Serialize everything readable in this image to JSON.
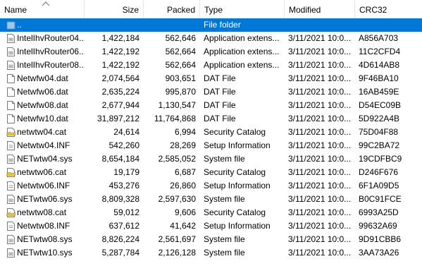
{
  "columns": {
    "name": "Name",
    "size": "Size",
    "packed": "Packed",
    "type": "Type",
    "modified": "Modified",
    "crc": "CRC32"
  },
  "rows": [
    {
      "name": "..",
      "size": "",
      "packed": "",
      "type": "File folder",
      "modified": "",
      "crc": "",
      "icon": "folder-up-icon",
      "selected": true
    },
    {
      "name": "IntelIhvRouter04...",
      "size": "1,422,184",
      "packed": "562,646",
      "type": "Application extens...",
      "modified": "3/11/2021 10:0...",
      "crc": "A856A703",
      "icon": "dll-file-icon"
    },
    {
      "name": "IntelIhvRouter06...",
      "size": "1,422,192",
      "packed": "562,664",
      "type": "Application extens...",
      "modified": "3/11/2021 10:0...",
      "crc": "11C2CFD4",
      "icon": "dll-file-icon"
    },
    {
      "name": "IntelIhvRouter08...",
      "size": "1,422,192",
      "packed": "562,664",
      "type": "Application extens...",
      "modified": "3/11/2021 10:0...",
      "crc": "4D614AB8",
      "icon": "dll-file-icon"
    },
    {
      "name": "Netwfw04.dat",
      "size": "2,074,564",
      "packed": "903,651",
      "type": "DAT File",
      "modified": "3/11/2021 10:0...",
      "crc": "9F46BA10",
      "icon": "file-icon"
    },
    {
      "name": "Netwfw06.dat",
      "size": "2,635,224",
      "packed": "995,870",
      "type": "DAT File",
      "modified": "3/11/2021 10:0...",
      "crc": "16AB459E",
      "icon": "file-icon"
    },
    {
      "name": "Netwfw08.dat",
      "size": "2,677,944",
      "packed": "1,130,547",
      "type": "DAT File",
      "modified": "3/11/2021 10:0...",
      "crc": "D54EC09B",
      "icon": "file-icon"
    },
    {
      "name": "Netwfw10.dat",
      "size": "31,897,212",
      "packed": "11,764,868",
      "type": "DAT File",
      "modified": "3/11/2021 10:0...",
      "crc": "5D922A4B",
      "icon": "file-icon"
    },
    {
      "name": "netwtw04.cat",
      "size": "24,614",
      "packed": "6,994",
      "type": "Security Catalog",
      "modified": "3/11/2021 10:0...",
      "crc": "75D04F88",
      "icon": "security-catalog-icon"
    },
    {
      "name": "Netwtw04.INF",
      "size": "542,260",
      "packed": "28,269",
      "type": "Setup Information",
      "modified": "3/11/2021 10:0...",
      "crc": "99C2BA72",
      "icon": "setup-info-icon"
    },
    {
      "name": "NETwtw04.sys",
      "size": "8,654,184",
      "packed": "2,585,052",
      "type": "System file",
      "modified": "3/11/2021 10:0...",
      "crc": "19CDFBC9",
      "icon": "system-file-icon"
    },
    {
      "name": "netwtw06.cat",
      "size": "19,179",
      "packed": "6,687",
      "type": "Security Catalog",
      "modified": "3/11/2021 10:0...",
      "crc": "D246F676",
      "icon": "security-catalog-icon"
    },
    {
      "name": "Netwtw06.INF",
      "size": "453,276",
      "packed": "26,860",
      "type": "Setup Information",
      "modified": "3/11/2021 10:0...",
      "crc": "6F1A09D5",
      "icon": "setup-info-icon"
    },
    {
      "name": "NETwtw06.sys",
      "size": "8,809,328",
      "packed": "2,597,630",
      "type": "System file",
      "modified": "3/11/2021 10:0...",
      "crc": "B0C91FCE",
      "icon": "system-file-icon"
    },
    {
      "name": "netwtw08.cat",
      "size": "59,012",
      "packed": "9,606",
      "type": "Security Catalog",
      "modified": "3/11/2021 10:0...",
      "crc": "6993A25D",
      "icon": "security-catalog-icon"
    },
    {
      "name": "Netwtw08.INF",
      "size": "637,612",
      "packed": "41,642",
      "type": "Setup Information",
      "modified": "3/11/2021 10:0...",
      "crc": "99632A69",
      "icon": "setup-info-icon"
    },
    {
      "name": "NETwtw08.sys",
      "size": "8,826,224",
      "packed": "2,561,697",
      "type": "System file",
      "modified": "3/11/2021 10:0...",
      "crc": "9D91CBB6",
      "icon": "system-file-icon"
    },
    {
      "name": "NETwtw10.sys",
      "size": "5,287,784",
      "packed": "2,126,128",
      "type": "System file",
      "modified": "3/11/2021 10:0...",
      "crc": "3AA73A26",
      "icon": "system-file-icon"
    }
  ],
  "colors": {
    "selection": "#0078d7",
    "header_divider": "#e5e5e5",
    "catalog_icon": "#e8c23a"
  }
}
